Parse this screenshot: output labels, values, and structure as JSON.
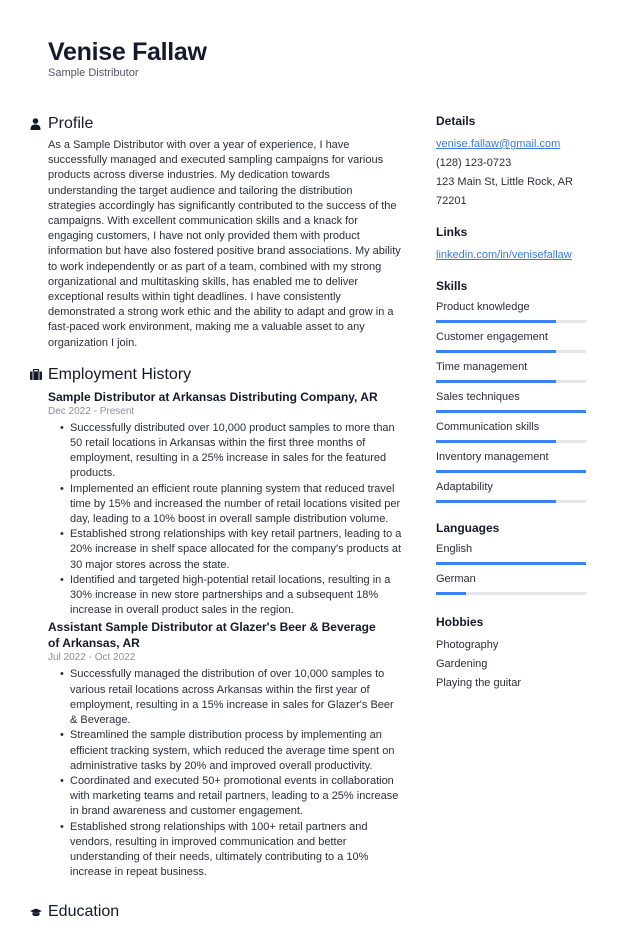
{
  "header": {
    "name": "Venise Fallaw",
    "title": "Sample Distributor"
  },
  "profile": {
    "heading": "Profile",
    "icon": "user-icon",
    "text": "As a Sample Distributor with over a year of experience, I have successfully managed and executed sampling campaigns for various products across diverse industries. My dedication towards understanding the target audience and tailoring the distribution strategies accordingly has significantly contributed to the success of the campaigns. With excellent communication skills and a knack for engaging customers, I have not only provided them with product information but have also fostered positive brand associations. My ability to work independently or as part of a team, combined with my strong organizational and multitasking skills, has enabled me to deliver exceptional results within tight deadlines. I have consistently demonstrated a strong work ethic and the ability to adapt and grow in a fast-paced work environment, making me a valuable asset to any organization I join."
  },
  "employment": {
    "heading": "Employment History",
    "icon": "briefcase-icon",
    "jobs": [
      {
        "title": "Sample Distributor at Arkansas Distributing Company, AR",
        "dates": "Dec 2022 - Present",
        "bullets": [
          "Successfully distributed over 10,000 product samples to more than 50 retail locations in Arkansas within the first three months of employment, resulting in a 25% increase in sales for the featured products.",
          "Implemented an efficient route planning system that reduced travel time by 15% and increased the number of retail locations visited per day, leading to a 10% boost in overall sample distribution volume.",
          "Established strong relationships with key retail partners, leading to a 20% increase in shelf space allocated for the company's products at 30 major stores across the state.",
          "Identified and targeted high-potential retail locations, resulting in a 30% increase in new store partnerships and a subsequent 18% increase in overall product sales in the region."
        ]
      },
      {
        "title": "Assistant Sample Distributor at Glazer's Beer & Beverage of Arkansas, AR",
        "dates": "Jul 2022 - Oct 2022",
        "bullets": [
          "Successfully managed the distribution of over 10,000 samples to various retail locations across Arkansas within the first year of employment, resulting in a 15% increase in sales for Glazer's Beer & Beverage.",
          "Streamlined the sample distribution process by implementing an efficient tracking system, which reduced the average time spent on administrative tasks by 20% and improved overall productivity.",
          "Coordinated and executed 50+ promotional events in collaboration with marketing teams and retail partners, leading to a 25% increase in brand awareness and customer engagement.",
          "Established strong relationships with 100+ retail partners and vendors, resulting in improved communication and better understanding of their needs, ultimately contributing to a 10% increase in repeat business."
        ]
      }
    ]
  },
  "education": {
    "heading": "Education",
    "icon": "graduation-cap-icon"
  },
  "details": {
    "heading": "Details",
    "email": "venise.fallaw@gmail.com",
    "phone": "(128) 123-0723",
    "address": "123 Main St, Little Rock, AR 72201"
  },
  "links": {
    "heading": "Links",
    "items": [
      "linkedin.com/in/venisefallaw"
    ]
  },
  "skills": {
    "heading": "Skills",
    "items": [
      {
        "name": "Product knowledge",
        "level": 0.8
      },
      {
        "name": "Customer engagement",
        "level": 0.8
      },
      {
        "name": "Time management",
        "level": 0.8
      },
      {
        "name": "Sales techniques",
        "level": 1.0
      },
      {
        "name": "Communication skills",
        "level": 0.8
      },
      {
        "name": "Inventory management",
        "level": 1.0
      },
      {
        "name": "Adaptability",
        "level": 0.8
      }
    ]
  },
  "languages": {
    "heading": "Languages",
    "items": [
      {
        "name": "English",
        "level": 1.0
      },
      {
        "name": "German",
        "level": 0.2
      }
    ]
  },
  "hobbies": {
    "heading": "Hobbies",
    "items": [
      "Photography",
      "Gardening",
      "Playing the guitar"
    ]
  },
  "colors": {
    "accent": "#3b82f6",
    "link": "#3a7bdc",
    "track": "#e4e6ea",
    "text": "#2a2f3b"
  }
}
